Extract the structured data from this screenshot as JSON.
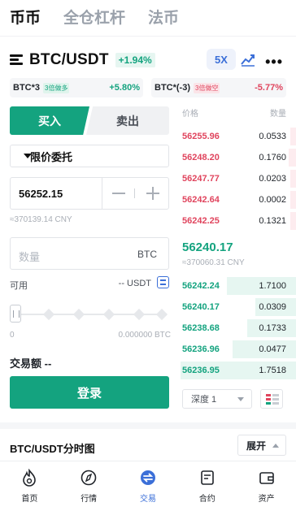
{
  "top_tabs": [
    "币币",
    "全仓杠杆",
    "法币"
  ],
  "pair": {
    "name": "BTC/USDT",
    "change": "+1.94%",
    "leverage": "5X"
  },
  "etf": [
    {
      "name": "BTC*3",
      "tag": "3倍做多",
      "change": "+5.80%"
    },
    {
      "name": "BTC*(-3)",
      "tag": "3倍做空",
      "change": "-5.77%"
    }
  ],
  "trade": {
    "buy_label": "买入",
    "sell_label": "卖出",
    "order_type": "限价委托",
    "price_value": "56252.15",
    "price_cny": "≈370139.14 CNY",
    "amount_placeholder": "数量",
    "amount_unit": "BTC",
    "available_label": "可用",
    "available_value": "-- USDT",
    "slider_min": "0",
    "slider_max": "0.000000 BTC",
    "slider_level": 0,
    "tx_label": "交易额 --",
    "login_label": "登录"
  },
  "orderbook": {
    "price_header": "价格",
    "qty_header": "数量",
    "asks": [
      {
        "price": "56255.96",
        "qty": "0.0533",
        "depth": 0.05
      },
      {
        "price": "56248.20",
        "qty": "0.1760",
        "depth": 0.06
      },
      {
        "price": "56247.77",
        "qty": "0.0203",
        "depth": 0.05
      },
      {
        "price": "56242.64",
        "qty": "0.0002",
        "depth": 0.05
      },
      {
        "price": "56242.25",
        "qty": "0.1321",
        "depth": 0.05
      }
    ],
    "last_price": "56240.17",
    "last_cny": "≈370060.31 CNY",
    "bids": [
      {
        "price": "56242.24",
        "qty": "1.7100",
        "depth": 0.6
      },
      {
        "price": "56240.17",
        "qty": "0.0309",
        "depth": 0.35
      },
      {
        "price": "56238.68",
        "qty": "0.1733",
        "depth": 0.42
      },
      {
        "price": "56236.96",
        "qty": "0.0477",
        "depth": 0.55
      },
      {
        "price": "56236.95",
        "qty": "1.7518",
        "depth": 1.0
      }
    ],
    "depth_label": "深度 1"
  },
  "chart_section": {
    "title": "BTC/USDT分时图",
    "expand_label": "展开"
  },
  "nav": [
    {
      "label": "首页",
      "icon": "home-flame-icon"
    },
    {
      "label": "行情",
      "icon": "market-compass-icon"
    },
    {
      "label": "交易",
      "icon": "trade-icon"
    },
    {
      "label": "合约",
      "icon": "contract-icon"
    },
    {
      "label": "资产",
      "icon": "wallet-icon"
    }
  ],
  "colors": {
    "green": "#14a37f",
    "red": "#e0455e",
    "blue": "#3b6fd8"
  }
}
